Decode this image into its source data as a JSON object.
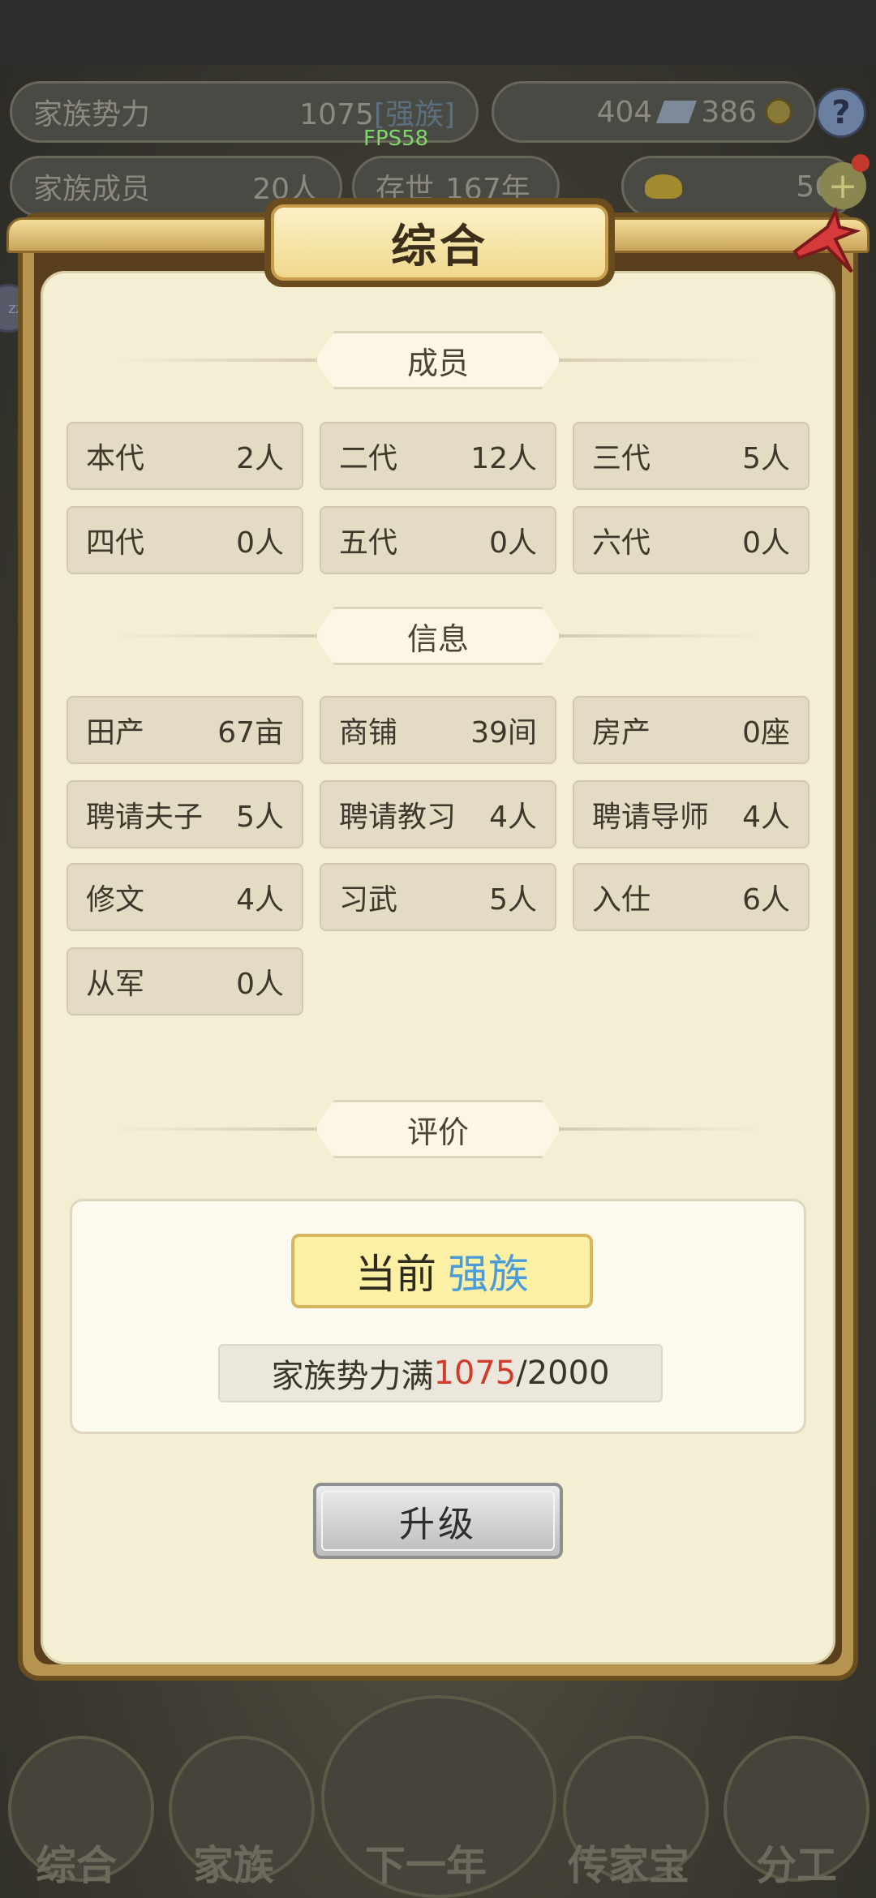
{
  "status_bar": {},
  "hud": {
    "power_label": "家族势力",
    "power_value": "1075",
    "power_rank": "[强族]",
    "members_label": "家族成员",
    "members_value": "20人",
    "age_label": "存世",
    "age_value": "167年",
    "resource_a": "404",
    "resource_b": "386",
    "gold_value": "56",
    "fps": "FPS58",
    "help": "?",
    "side_bubble": "zz"
  },
  "dialog": {
    "title": "综合",
    "sections": {
      "members": "成员",
      "info": "信息",
      "evaluation": "评价"
    },
    "members": [
      {
        "label": "本代",
        "value": "2人"
      },
      {
        "label": "二代",
        "value": "12人"
      },
      {
        "label": "三代",
        "value": "5人"
      },
      {
        "label": "四代",
        "value": "0人"
      },
      {
        "label": "五代",
        "value": "0人"
      },
      {
        "label": "六代",
        "value": "0人"
      }
    ],
    "info": [
      {
        "label": "田产",
        "value": "67亩"
      },
      {
        "label": "商铺",
        "value": "39间"
      },
      {
        "label": "房产",
        "value": "0座"
      },
      {
        "label": "聘请夫子",
        "value": "5人"
      },
      {
        "label": "聘请教习",
        "value": "4人"
      },
      {
        "label": "聘请导师",
        "value": "4人"
      },
      {
        "label": "修文",
        "value": "4人"
      },
      {
        "label": "习武",
        "value": "5人"
      },
      {
        "label": "入仕",
        "value": "6人"
      },
      {
        "label": "从军",
        "value": "0人"
      }
    ],
    "evaluation": {
      "current_label": "当前",
      "current_rank": "强族",
      "progress_prefix": "家族势力满",
      "progress_current": "1075",
      "progress_max": "/2000"
    },
    "upgrade_label": "升级"
  },
  "bottom_nav": {
    "items": [
      "综合",
      "家族",
      "下一年",
      "传家宝",
      "分工"
    ]
  },
  "colors": {
    "panel_bg": "#f4efd3",
    "cell_bg": "#e4dbc4",
    "rank_blue": "#4a9bd8",
    "progress_red": "#d23b2b",
    "frame_gold": "#b89451"
  }
}
